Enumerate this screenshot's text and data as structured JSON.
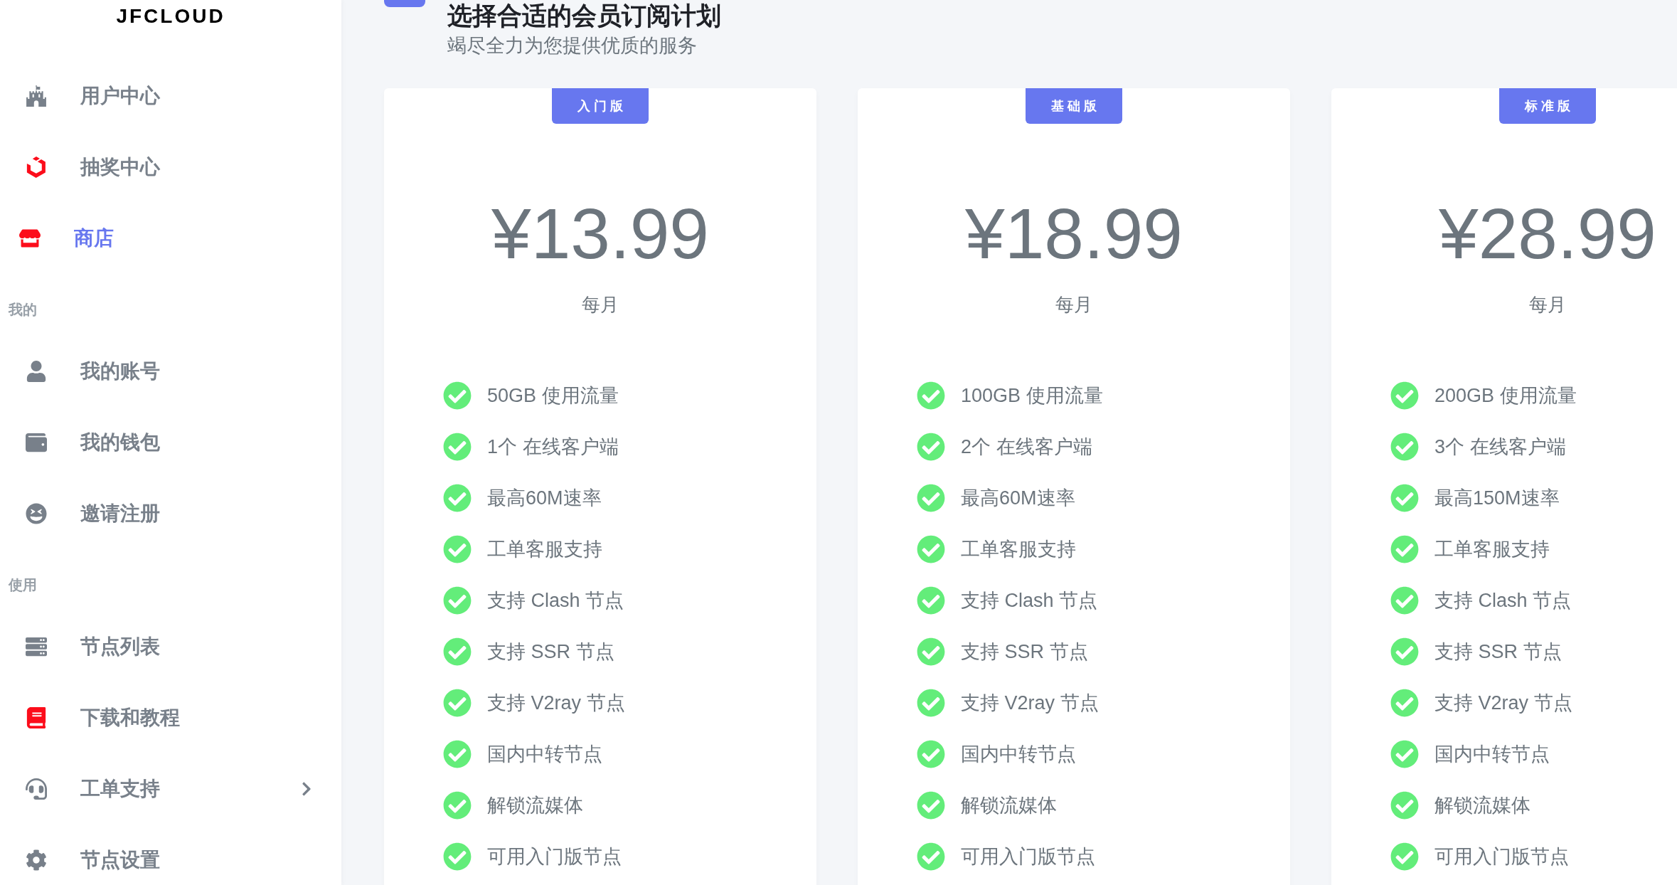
{
  "sidebar": {
    "logo": "JFCLOUD",
    "sections": [
      {
        "items": [
          {
            "label": "用户中心",
            "selected": false,
            "color": "#78808a",
            "dropdown": false
          },
          {
            "label": "抽奖中心",
            "selected": false,
            "color": "#fc0d1b",
            "dropdown": false
          },
          {
            "label": "商店",
            "selected": true,
            "color": "#fc0d1b",
            "dropdown": false
          }
        ]
      },
      {
        "heading": "我的",
        "items": [
          {
            "label": "我的账号",
            "selected": false,
            "color": "#78808a",
            "dropdown": false
          },
          {
            "label": "我的钱包",
            "selected": false,
            "color": "#78808a",
            "dropdown": false
          },
          {
            "label": "邀请注册",
            "selected": false,
            "color": "#78808a",
            "dropdown": false
          }
        ]
      },
      {
        "heading": "使用",
        "items": [
          {
            "label": "节点列表",
            "selected": false,
            "color": "#78808a",
            "dropdown": false
          },
          {
            "label": "下载和教程",
            "selected": false,
            "color": "#fc0d1b",
            "dropdown": false
          },
          {
            "label": "工单支持",
            "selected": false,
            "color": "#78808a",
            "dropdown": true
          },
          {
            "label": "节点设置",
            "selected": false,
            "color": "#78808a",
            "dropdown": false
          }
        ]
      }
    ]
  },
  "header": {
    "title": "选择合适的会员订阅计划",
    "subtitle": "竭尽全力为您提供优质的服务"
  },
  "plans": [
    {
      "badge": "入门版",
      "price": "¥13.99",
      "period": "每月",
      "features": [
        {
          "text": "50GB 使用流量",
          "included": true
        },
        {
          "text": "1个 在线客户端",
          "included": true
        },
        {
          "text": "最高60M速率",
          "included": true
        },
        {
          "text": "工单客服支持",
          "included": true
        },
        {
          "text": "支持 Clash 节点",
          "included": true
        },
        {
          "text": "支持 SSR 节点",
          "included": true
        },
        {
          "text": "支持 V2ray 节点",
          "included": true
        },
        {
          "text": "国内中转节点",
          "included": true
        },
        {
          "text": "解锁流媒体",
          "included": true
        },
        {
          "text": "可用入门版节点",
          "included": true
        }
      ]
    },
    {
      "badge": "基础版",
      "price": "¥18.99",
      "period": "每月",
      "features": [
        {
          "text": "100GB 使用流量",
          "included": true
        },
        {
          "text": "2个 在线客户端",
          "included": true
        },
        {
          "text": "最高60M速率",
          "included": true
        },
        {
          "text": "工单客服支持",
          "included": true
        },
        {
          "text": "支持 Clash 节点",
          "included": true
        },
        {
          "text": "支持 SSR 节点",
          "included": true
        },
        {
          "text": "支持 V2ray 节点",
          "included": true
        },
        {
          "text": "国内中转节点",
          "included": true
        },
        {
          "text": "解锁流媒体",
          "included": true
        },
        {
          "text": "可用入门版节点",
          "included": true
        }
      ]
    },
    {
      "badge": "标准版",
      "price": "¥28.99",
      "period": "每月",
      "features": [
        {
          "text": "200GB 使用流量",
          "included": true
        },
        {
          "text": "3个 在线客户端",
          "included": true
        },
        {
          "text": "最高150M速率",
          "included": true
        },
        {
          "text": "工单客服支持",
          "included": true
        },
        {
          "text": "支持 Clash 节点",
          "included": true
        },
        {
          "text": "支持 SSR 节点",
          "included": true
        },
        {
          "text": "支持 V2ray 节点",
          "included": true
        },
        {
          "text": "国内中转节点",
          "included": true
        },
        {
          "text": "解锁流媒体",
          "included": true
        },
        {
          "text": "可用入门版节点",
          "included": true
        }
      ]
    }
  ]
}
